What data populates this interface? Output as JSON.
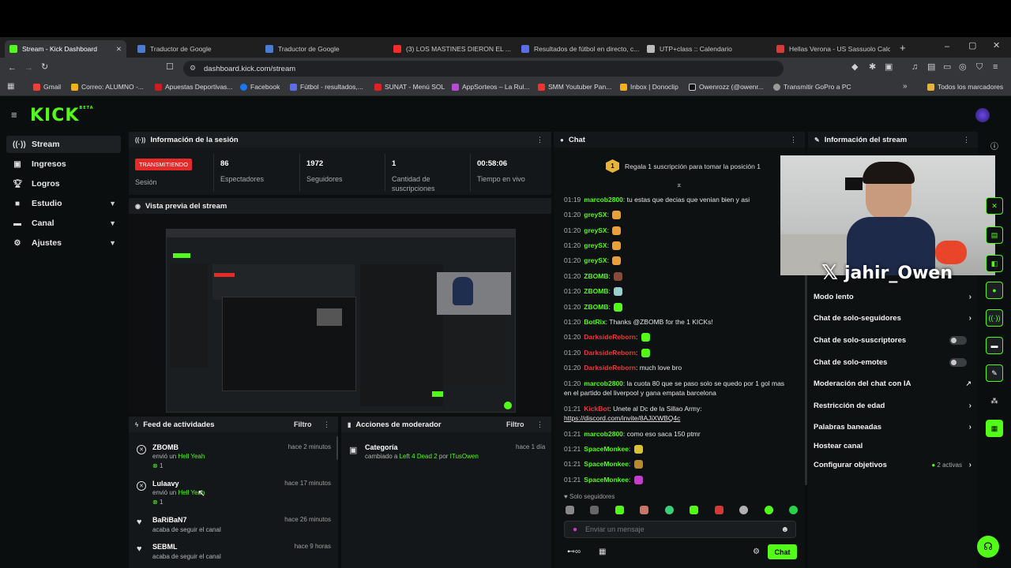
{
  "browser": {
    "tabs": [
      {
        "title": "Stream - Kick Dashboard",
        "active": true,
        "color": "#53fc18"
      },
      {
        "title": "Traductor de Google",
        "color": "#4a7bd6"
      },
      {
        "title": "Traductor de Google",
        "color": "#4a7bd6"
      },
      {
        "title": "(3) LOS MASTINES DIERON EL ...",
        "color": "#ff2a2a"
      },
      {
        "title": "Resultados de fútbol en directo, c...",
        "color": "#5b6de8"
      },
      {
        "title": "UTP+class :: Calendario",
        "color": "#bbbbbb"
      },
      {
        "title": "Hellas Verona - US Sassuolo Calcio",
        "color": "#d83a3a"
      }
    ],
    "url": "dashboard.kick.com/stream",
    "bookmarks": [
      "Gmail",
      "Correo: ALUMNO -...",
      "Apuestas Deportivas...",
      "Facebook",
      "Fútbol - resultados,...",
      "SUNAT - Menú SOL",
      "AppSorteos – La Rul...",
      "SMM Youtuber Pan...",
      "Inbox | Donoclip",
      "Owenrozz (@owenr...",
      "Transmitir GoPro a PC"
    ],
    "all_bookmarks": "Todos los marcadores"
  },
  "kick": {
    "logo": "KICK",
    "logo_badge": "BETA",
    "nav": [
      {
        "label": "Stream",
        "icon": "stream-icon",
        "active": true
      },
      {
        "label": "Ingresos",
        "icon": "wallet-icon"
      },
      {
        "label": "Logros",
        "icon": "trophy-icon"
      },
      {
        "label": "Estudio",
        "icon": "studio-icon",
        "expandable": true
      },
      {
        "label": "Canal",
        "icon": "channel-icon",
        "expandable": true
      },
      {
        "label": "Ajustes",
        "icon": "gear-icon",
        "expandable": true
      }
    ]
  },
  "session": {
    "title": "Información de la sesión",
    "live_badge": "TRANSMITIENDO",
    "session_label": "Sesión",
    "stats": [
      {
        "value": "86",
        "label": "Espectadores"
      },
      {
        "value": "1972",
        "label": "Seguidores"
      },
      {
        "value": "1",
        "label": "Cantidad de suscripciones"
      },
      {
        "value": "00:58:06",
        "label": "Tiempo en vivo"
      }
    ]
  },
  "preview": {
    "title": "Vista previa del stream"
  },
  "activity": {
    "title": "Feed de actividades",
    "filter": "Filtro",
    "items": [
      {
        "user": "ZBOMB",
        "action": "envió un",
        "item": "Hell Yeah",
        "count": "1",
        "time": "hace 2 minutos"
      },
      {
        "user": "Lulaavy",
        "action": "envió un",
        "item": "Hell Yeah",
        "count": "1",
        "time": "hace 17 minutos"
      },
      {
        "user": "BaRiBaN7",
        "action": "acaba de seguir el canal",
        "time": "hace 26 minutos"
      },
      {
        "user": "SEBML",
        "action": "acaba de seguir el canal",
        "time": "hace 9 horas"
      }
    ]
  },
  "moderator": {
    "title": "Acciones de moderador",
    "filter": "Filtro",
    "items": [
      {
        "title": "Categoría",
        "prefix": "cambiado a",
        "value": "Left 4 Dead 2",
        "by": "por",
        "user": "ITusOwen",
        "time": "hace 1 día"
      }
    ]
  },
  "chat": {
    "title": "Chat",
    "gift_banner": "Regala 1 suscripción para tomar la posición 1",
    "gift_badge": "1",
    "messages": [
      {
        "time": "01:19",
        "user": "marcob2800",
        "color": "#53fc18",
        "text": "tu estas que decias que venian bien y asi"
      },
      {
        "time": "01:20",
        "user": "greySX",
        "color": "#53fc18",
        "text": "",
        "emote": "#e8a13a"
      },
      {
        "time": "01:20",
        "user": "greySX",
        "color": "#53fc18",
        "text": "",
        "emote": "#e8a13a"
      },
      {
        "time": "01:20",
        "user": "greySX",
        "color": "#53fc18",
        "text": "",
        "emote": "#e8a13a"
      },
      {
        "time": "01:20",
        "user": "greySX",
        "color": "#53fc18",
        "text": "",
        "emote": "#e8a13a"
      },
      {
        "time": "01:20",
        "user": "ZBOMB",
        "color": "#53fc18",
        "text": "",
        "emote": "#8a4a3a"
      },
      {
        "time": "01:20",
        "user": "ZBOMB",
        "color": "#53fc18",
        "text": "",
        "emote": "#9ad0d0"
      },
      {
        "time": "01:20",
        "user": "ZBOMB",
        "color": "#53fc18",
        "text": "",
        "emote": "#53fc18"
      },
      {
        "time": "01:20",
        "user": "BotRix",
        "color": "#53fc18",
        "text": "Thanks @ZBOMB for the 1 KICKs!"
      },
      {
        "time": "01:20",
        "user": "DarksideReborn",
        "color": "#e83a3a",
        "text": "",
        "emote": "#53fc18"
      },
      {
        "time": "01:20",
        "user": "DarksideReborn",
        "color": "#e83a3a",
        "text": "",
        "emote": "#53fc18"
      },
      {
        "time": "01:20",
        "user": "DarksideReborn",
        "color": "#e83a3a",
        "text": "much love bro"
      },
      {
        "time": "01:20",
        "user": "marcob2800",
        "color": "#53fc18",
        "text": "la cuota 80 que se paso solo se quedo por 1 gol mas",
        "text2": "en el partido del liverpool y gana empata barcelona"
      },
      {
        "time": "01:21",
        "user": "KickBot",
        "color": "#e83a3a",
        "text": "Unete al Dc de la Sillao Army:",
        "text2": "https://discord.com/invite/8AJiXWBQ4c"
      },
      {
        "time": "01:21",
        "user": "marcob2800",
        "color": "#53fc18",
        "text": "como eso saca 150 ptmr"
      },
      {
        "time": "01:21",
        "user": "SpaceMonkee",
        "color": "#53fc18",
        "text": "",
        "emote": "#d9c13a"
      },
      {
        "time": "01:21",
        "user": "SpaceMonkee",
        "color": "#53fc18",
        "text": "",
        "emote": "#b88a2a"
      },
      {
        "time": "01:21",
        "user": "SpaceMonkee",
        "color": "#53fc18",
        "text": "",
        "emote": "#c93ad0"
      }
    ],
    "followers_only": "Solo seguidores",
    "input_placeholder": "Enviar un mensaje",
    "send_button": "Chat"
  },
  "stream_info": {
    "title": "Información del stream",
    "webcam_name": "jahir_Owen",
    "settings": [
      {
        "label": "Modo lento",
        "control": "chevron"
      },
      {
        "label": "Chat de solo-seguidores",
        "control": "chevron"
      },
      {
        "label": "Chat de solo-suscriptores",
        "control": "toggle"
      },
      {
        "label": "Chat de solo-emotes",
        "control": "toggle"
      },
      {
        "label": "Moderación del chat con IA",
        "control": "link"
      },
      {
        "label": "Restricción de edad",
        "control": "chevron"
      },
      {
        "label": "Palabras baneadas",
        "control": "chevron"
      },
      {
        "label": "Hostear canal",
        "control": "none"
      },
      {
        "label": "Configurar objetivos",
        "control": "chevron",
        "badge": "2 activas"
      }
    ]
  }
}
